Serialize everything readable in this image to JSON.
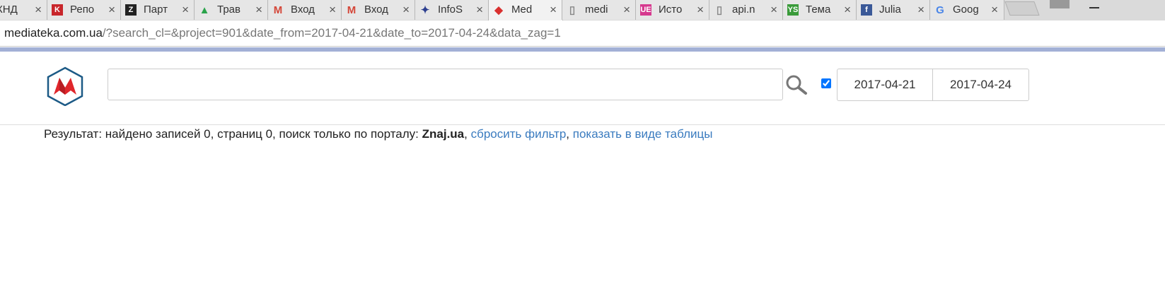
{
  "tabs": [
    {
      "label": "КНД",
      "icon": "arrow-icon",
      "color": "#444444"
    },
    {
      "label": "Репо",
      "icon": "k-icon",
      "color": "#c8262b"
    },
    {
      "label": "Парт",
      "icon": "znaj-icon",
      "color": "#222222"
    },
    {
      "label": "Трав",
      "icon": "drive-icon",
      "color": "#2aa34a"
    },
    {
      "label": "Вход",
      "icon": "gmail-icon",
      "color": "#d44638"
    },
    {
      "label": "Вход",
      "icon": "gmail-icon",
      "color": "#d44638"
    },
    {
      "label": "InfoS",
      "icon": "infos-icon",
      "color": "#2c3e8f"
    },
    {
      "label": "Med",
      "icon": "mediateka-icon",
      "color": "#d9302f",
      "active": true
    },
    {
      "label": "medi",
      "icon": "page-icon",
      "color": "#888888"
    },
    {
      "label": "Исто",
      "icon": "ue-icon",
      "color": "#d6398e"
    },
    {
      "label": "api.n",
      "icon": "page-icon",
      "color": "#888888"
    },
    {
      "label": "Тема",
      "icon": "ys-icon",
      "color": "#3a9b3a"
    },
    {
      "label": "Julia",
      "icon": "facebook-icon",
      "color": "#3b5998"
    },
    {
      "label": "Goog",
      "icon": "google-translate-icon",
      "color": "#4a86e8"
    }
  ],
  "address": {
    "host": "mediateka.com.ua",
    "path": "/?search_cl=&project=901&date_from=2017-04-21&date_to=2017-04-24&data_zag=1"
  },
  "search": {
    "value": "",
    "placeholder": ""
  },
  "dates": {
    "from": "2017-04-21",
    "to": "2017-04-24",
    "checked": true
  },
  "result": {
    "text": "Результат: найдено записей 0, страниц 0, поиск только по порталу: ",
    "portal": "Znaj.ua",
    "sep1": ", ",
    "reset_link": "сбросить фильтр",
    "sep2": ", ",
    "table_link": "показать в виде таблицы"
  },
  "colors": {
    "accent_bar": "#a2b0d6",
    "link": "#3a7bbf",
    "logo_red": "#e0262b",
    "logo_border": "#1c5a86"
  }
}
